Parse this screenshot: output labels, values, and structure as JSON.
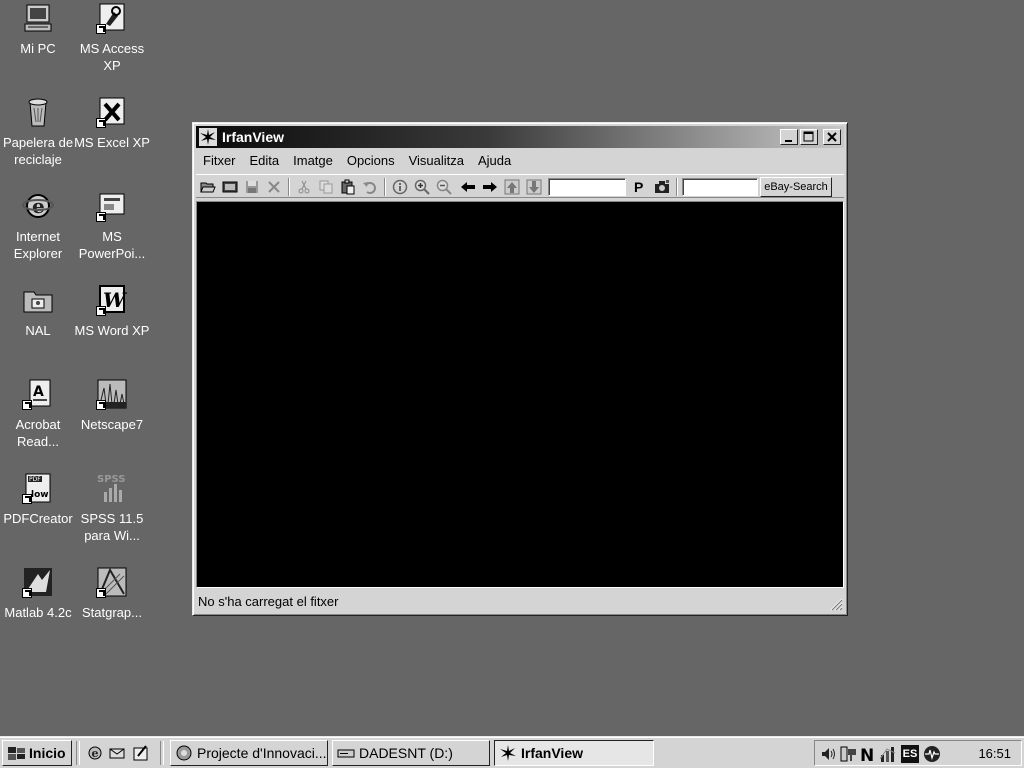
{
  "desktop": {
    "icons": [
      {
        "label": "Mi PC",
        "icon": "computer-icon"
      },
      {
        "label": "MS Access XP",
        "icon": "access-icon"
      },
      {
        "label": "Papelera de reciclaje",
        "icon": "recycle-bin-icon"
      },
      {
        "label": "MS Excel XP",
        "icon": "excel-icon"
      },
      {
        "label": "Internet Explorer",
        "icon": "ie-icon"
      },
      {
        "label": "MS PowerPoi...",
        "icon": "powerpoint-icon"
      },
      {
        "label": "NAL",
        "icon": "nal-icon"
      },
      {
        "label": "MS Word XP",
        "icon": "word-icon"
      },
      {
        "label": "Acrobat Read...",
        "icon": "acrobat-icon"
      },
      {
        "label": "Netscape7",
        "icon": "netscape-icon"
      },
      {
        "label": "PDFCreator",
        "icon": "pdfcreator-icon"
      },
      {
        "label": "SPSS 11.5 para Wi...",
        "icon": "spss-icon"
      },
      {
        "label": "Matlab 4.2c",
        "icon": "matlab-icon"
      },
      {
        "label": "Statgrap...",
        "icon": "statgraphics-icon"
      }
    ]
  },
  "window": {
    "title": "IrfanView",
    "menu": [
      "Fitxer",
      "Edita",
      "Imatge",
      "Opcions",
      "Visualitza",
      "Ajuda"
    ],
    "toolbar": {
      "page_label": "P",
      "page_input_value": "",
      "ebay_input_value": "",
      "ebay_button": "eBay-Search"
    },
    "status": "No s'ha carregat el fitxer",
    "viewer_background": "#000000"
  },
  "taskbar": {
    "start_label": "Inicio",
    "tasks": [
      {
        "label": "Projecte d'Innovaci...",
        "icon": "browser-icon",
        "active": false
      },
      {
        "label": "DADESNT (D:)",
        "icon": "drive-icon",
        "active": false
      },
      {
        "label": "IrfanView",
        "icon": "irfanview-icon",
        "active": true
      }
    ],
    "tray_language": "ES",
    "clock": "16:51"
  }
}
